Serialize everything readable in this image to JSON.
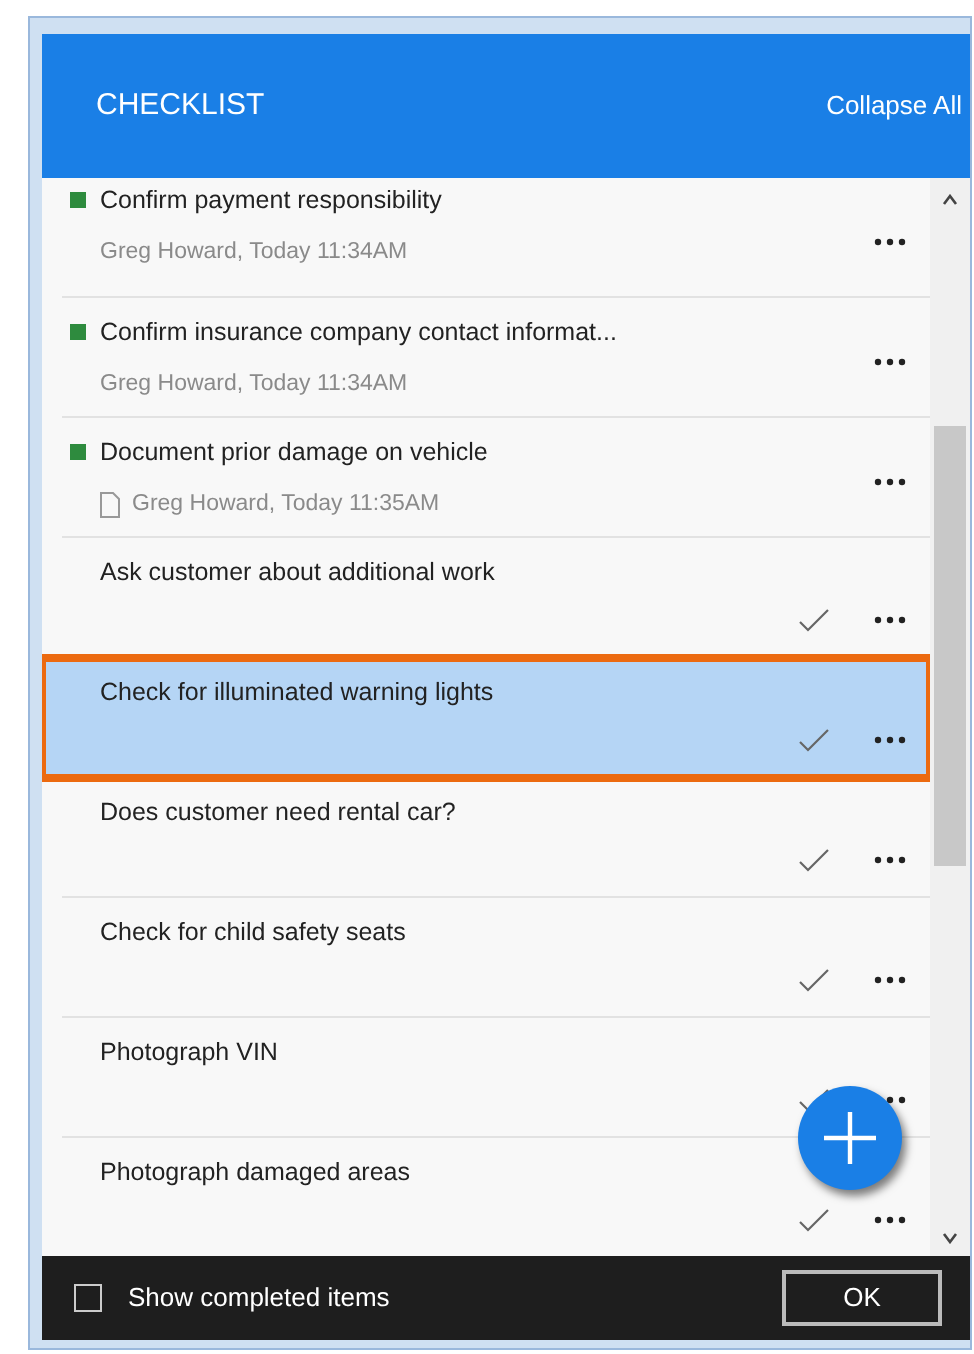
{
  "header": {
    "title": "CHECKLIST",
    "action": "Collapse All"
  },
  "items": [
    {
      "kind": "completed",
      "title": "Confirm payment responsibility",
      "meta": "Greg Howard, Today 11:34AM",
      "attachment": false,
      "selected": false
    },
    {
      "kind": "completed",
      "title": "Confirm insurance company contact informat...",
      "meta": "Greg Howard, Today 11:34AM",
      "attachment": false,
      "selected": false
    },
    {
      "kind": "completed",
      "title": "Document prior damage on vehicle",
      "meta": "Greg Howard, Today 11:35AM",
      "attachment": true,
      "selected": false
    },
    {
      "kind": "pending",
      "title": "Ask customer about additional work",
      "selected": false
    },
    {
      "kind": "pending",
      "title": "Check for illuminated warning lights",
      "selected": true
    },
    {
      "kind": "pending",
      "title": "Does customer need rental car?",
      "selected": false
    },
    {
      "kind": "pending",
      "title": "Check for child safety seats",
      "selected": false
    },
    {
      "kind": "pending",
      "title": "Photograph VIN",
      "selected": false
    },
    {
      "kind": "pending",
      "title": "Photograph damaged areas",
      "selected": false
    }
  ],
  "footer": {
    "checkbox_label": "Show completed items",
    "checked": false,
    "button": "OK"
  }
}
